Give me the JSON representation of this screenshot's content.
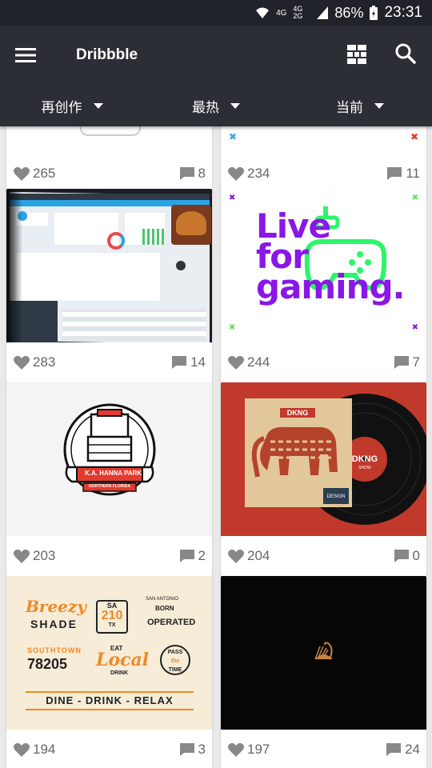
{
  "status": {
    "network1": "4G",
    "network2": "4G 2G",
    "battery": "86%",
    "time": "23:31"
  },
  "app": {
    "title": "Dribbble"
  },
  "filters": [
    {
      "label": "再创作"
    },
    {
      "label": "最热"
    },
    {
      "label": "当前"
    }
  ],
  "shots": [
    {
      "likes": "265",
      "comments": "8"
    },
    {
      "likes": "234",
      "comments": "11"
    },
    {
      "likes": "283",
      "comments": "14"
    },
    {
      "likes": "244",
      "comments": "7",
      "art": {
        "line1": "Live",
        "line2": "for",
        "line3": "gaming."
      }
    },
    {
      "likes": "203",
      "comments": "2",
      "art": {
        "banner": "K.A. HANNA PARK",
        "sub": "NORTHERN FLORIDA"
      }
    },
    {
      "likes": "204",
      "comments": "0",
      "art": {
        "label": "DKNG",
        "sub": "SHOW",
        "tag": "DESIGN"
      }
    },
    {
      "likes": "194",
      "comments": "3",
      "art": {
        "a1": "Breezy",
        "a2": "SHADE",
        "b1": "SA",
        "b2": "210",
        "b3": "TX",
        "c1": "SAN ANTONIO",
        "c2": "BORN",
        "c3": "OPERATED",
        "d1": "SOUTHTOWN",
        "d2": "78205",
        "e1": "EAT",
        "e2": "Local",
        "e3": "DRINK",
        "f1": "PASS",
        "f2": "the",
        "f3": "TIME",
        "g": "DINE - DRINK - RELAX"
      }
    },
    {
      "likes": "197",
      "comments": "24"
    }
  ],
  "colors": {
    "appbar": "#2b2e34",
    "statusbar": "#202329",
    "gaming_purple": "#8a17e6",
    "gaming_green": "#2cf56b",
    "dkng_red": "#c0392b",
    "poster_orange": "#ef8a25"
  }
}
